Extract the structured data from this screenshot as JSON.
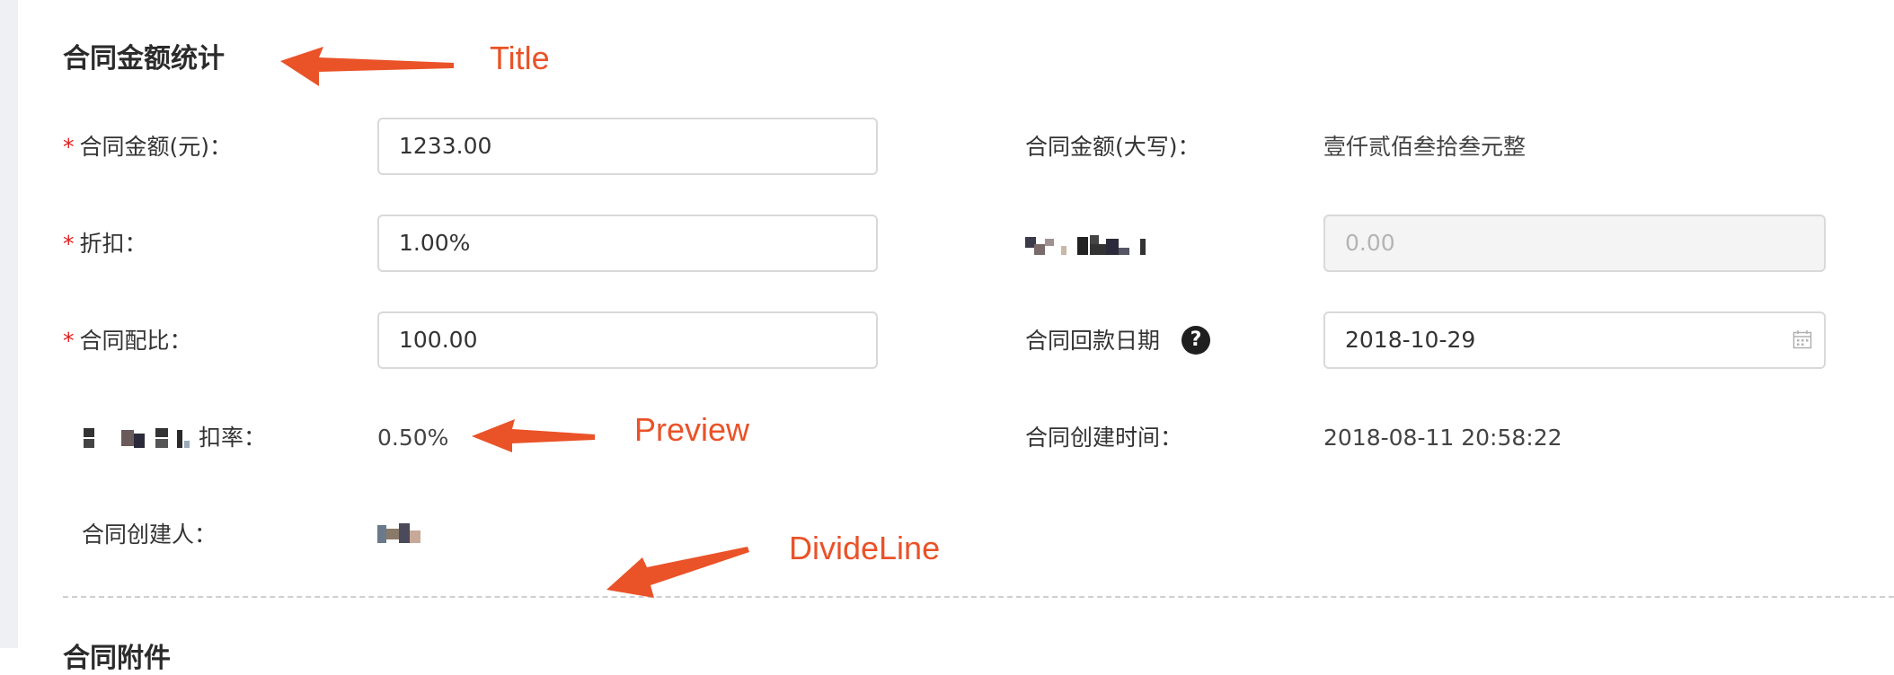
{
  "section": {
    "title": "合同金额统计",
    "next_title": "合同附件"
  },
  "fields": {
    "amount": {
      "required": "*",
      "label": "合同金额(元)：",
      "value": "1233.00"
    },
    "amount_upper": {
      "label": "合同金额(大写)：",
      "value": "壹仟贰佰叁拾叁元整"
    },
    "discount": {
      "required": "*",
      "label": "折扣：",
      "value": "1.00%"
    },
    "obscured_field": {
      "value": "0.00"
    },
    "ratio": {
      "required": "*",
      "label": "合同配比：",
      "value": "100.00"
    },
    "payment_date": {
      "label": "合同回款日期",
      "help": "?",
      "value": "2018-10-29"
    },
    "rate": {
      "label_suffix": "扣率：",
      "value": "0.50%"
    },
    "created_time": {
      "label": "合同创建时间：",
      "value": "2018-08-11 20:58:22"
    },
    "creator": {
      "label": "合同创建人："
    }
  },
  "annotations": {
    "title": "Title",
    "preview": "Preview",
    "divide_line": "DivideLine"
  },
  "colors": {
    "annotation": "#ea5228",
    "required": "#e02020",
    "border": "#d9d9d9"
  },
  "icons": [
    "help-icon",
    "calendar-icon"
  ]
}
